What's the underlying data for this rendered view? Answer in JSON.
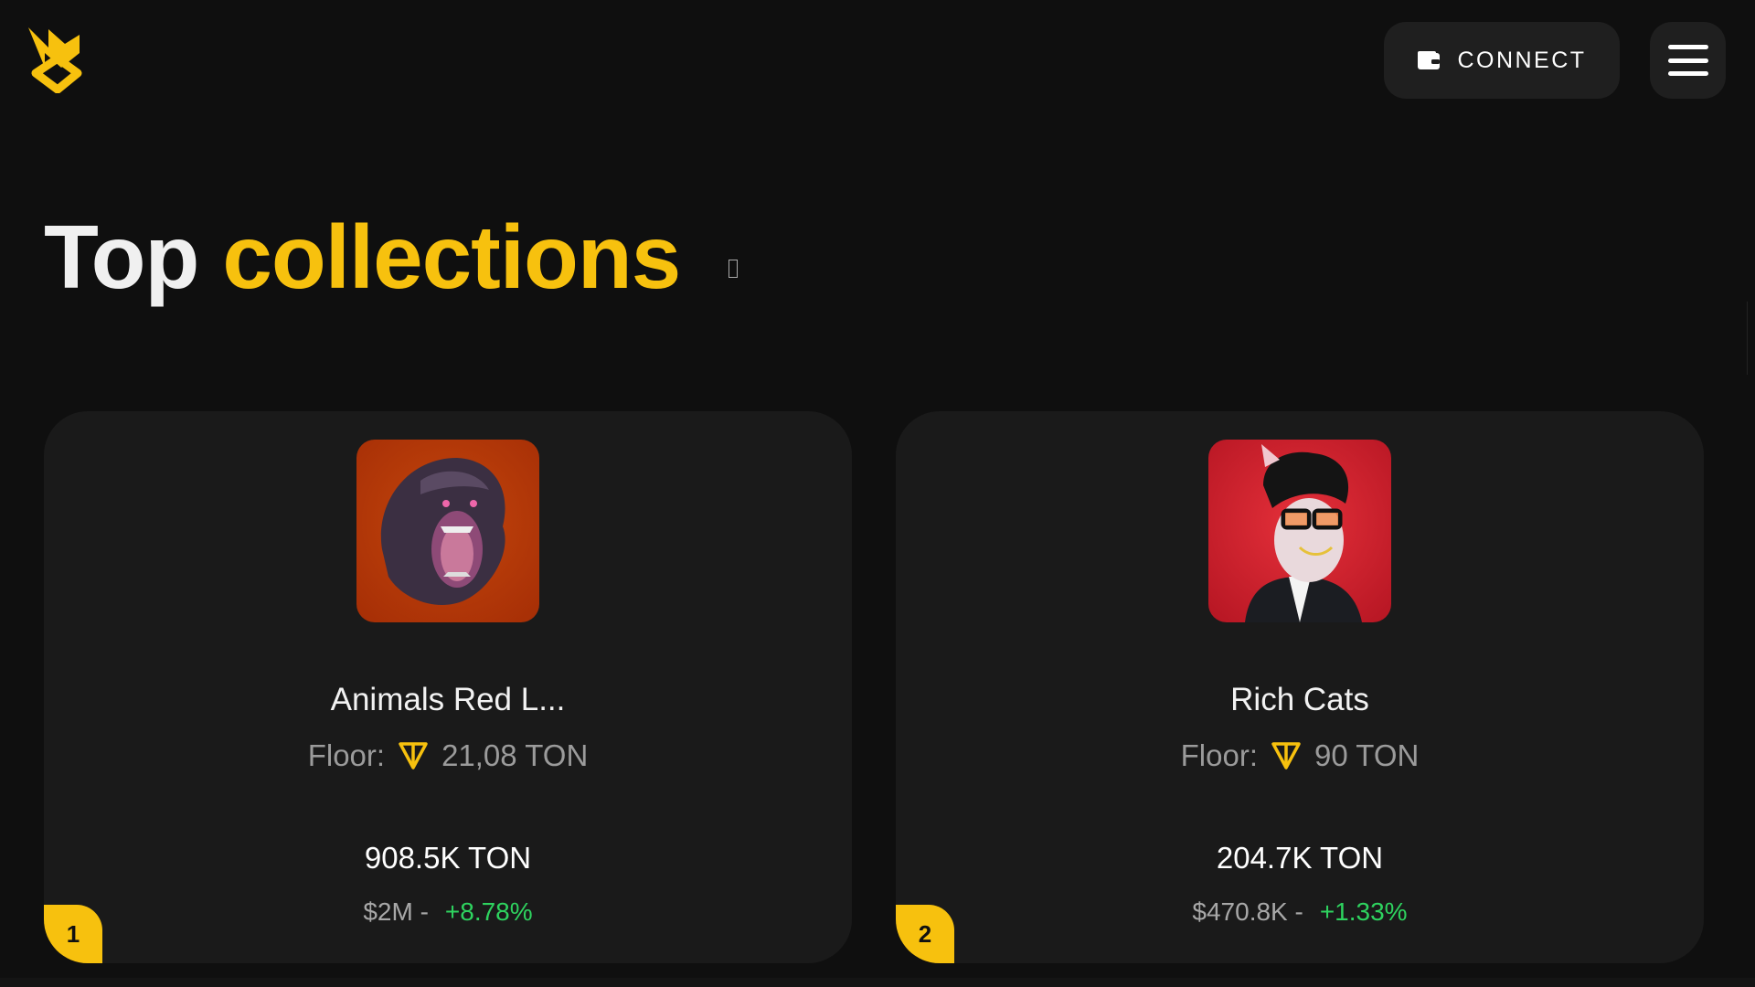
{
  "header": {
    "connect_label": "CONNECT",
    "icons": [
      "logo-icon",
      "wallet-icon",
      "hamburger-menu-icon"
    ]
  },
  "page": {
    "title_part1": "Top",
    "title_part2": "collections"
  },
  "colors": {
    "background": "#0f0f0f",
    "card": "#1a1a1a",
    "accent": "#f7c10e",
    "positive": "#2ed35f",
    "muted": "#9b9b9b"
  },
  "collections": [
    {
      "rank": "1",
      "name": "Animals Red L...",
      "floor_label": "Floor:",
      "floor_value": "21,08 TON",
      "volume": "908.5K TON",
      "usd": "$2M -",
      "change": "+8.78%",
      "image": "gorilla-avatar"
    },
    {
      "rank": "2",
      "name": "Rich Cats",
      "floor_label": "Floor:",
      "floor_value": "90 TON",
      "volume": "204.7K TON",
      "usd": "$470.8K -",
      "change": "+1.33%",
      "image": "cat-avatar"
    }
  ]
}
